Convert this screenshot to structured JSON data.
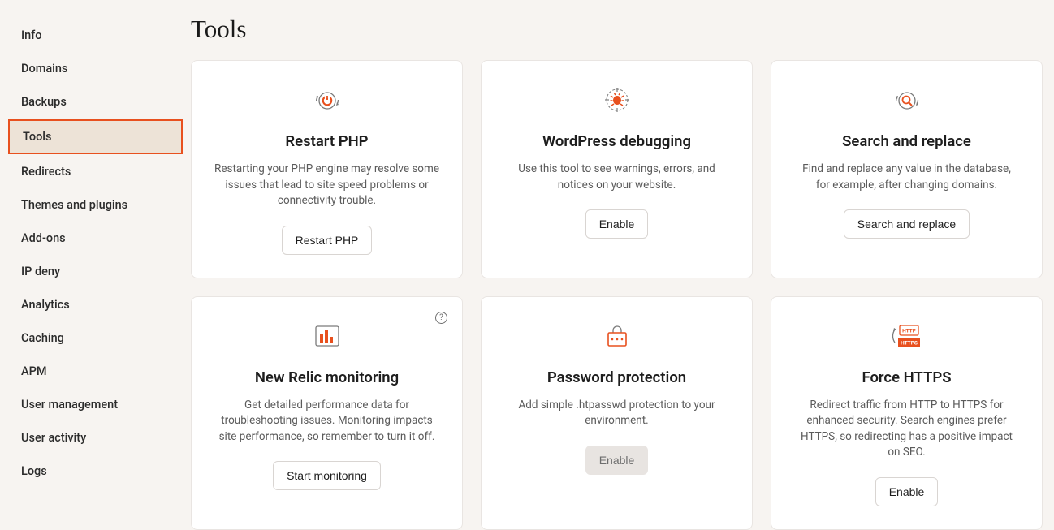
{
  "sidebar": {
    "items": [
      {
        "label": "Info"
      },
      {
        "label": "Domains"
      },
      {
        "label": "Backups"
      },
      {
        "label": "Tools",
        "active": true
      },
      {
        "label": "Redirects"
      },
      {
        "label": "Themes and plugins"
      },
      {
        "label": "Add-ons"
      },
      {
        "label": "IP deny"
      },
      {
        "label": "Analytics"
      },
      {
        "label": "Caching"
      },
      {
        "label": "APM"
      },
      {
        "label": "User management"
      },
      {
        "label": "User activity"
      },
      {
        "label": "Logs"
      }
    ]
  },
  "page": {
    "title": "Tools"
  },
  "cards": {
    "restart_php": {
      "title": "Restart PHP",
      "desc": "Restarting your PHP engine may resolve some issues that lead to site speed problems or connectivity trouble.",
      "button": "Restart PHP"
    },
    "wp_debug": {
      "title": "WordPress debugging",
      "desc": "Use this tool to see warnings, errors, and notices on your website.",
      "button": "Enable"
    },
    "search_replace": {
      "title": "Search and replace",
      "desc": "Find and replace any value in the database, for example, after changing domains.",
      "button": "Search and replace"
    },
    "new_relic": {
      "title": "New Relic monitoring",
      "desc": "Get detailed performance data for troubleshooting issues. Monitoring impacts site performance, so remember to turn it off.",
      "button": "Start monitoring",
      "help": "?"
    },
    "password_protect": {
      "title": "Password protection",
      "desc": "Add simple .htpasswd protection to your environment.",
      "button": "Enable"
    },
    "force_https": {
      "title": "Force HTTPS",
      "desc": "Redirect traffic from HTTP to HTTPS for enhanced security. Search engines prefer HTTPS, so redirecting has a positive impact on SEO.",
      "button": "Enable",
      "http_label": "HTTP",
      "https_label": "HTTPS"
    }
  }
}
